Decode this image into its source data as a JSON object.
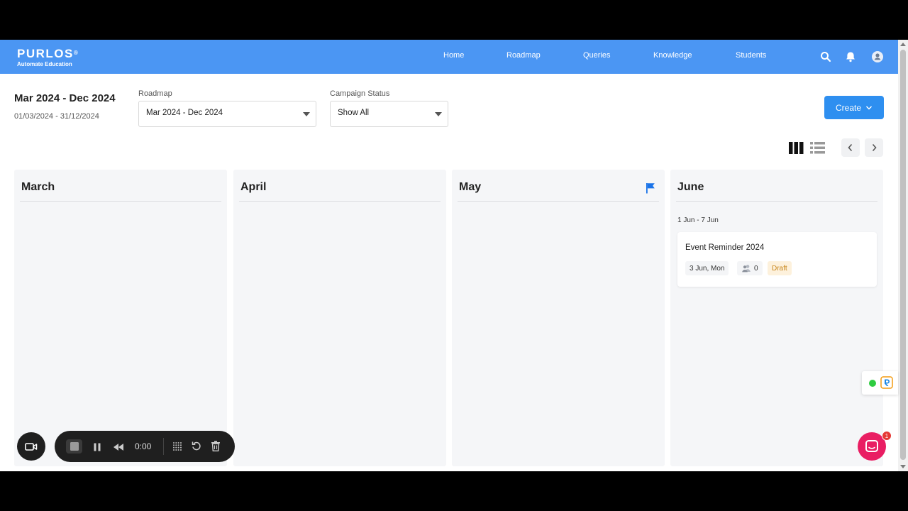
{
  "brand": {
    "name": "PURLOS",
    "mark": "®",
    "tagline": "Automate Education"
  },
  "nav": {
    "items": [
      {
        "label": "Home"
      },
      {
        "label": "Roadmap"
      },
      {
        "label": "Queries"
      },
      {
        "label": "Knowledge"
      },
      {
        "label": "Students"
      }
    ],
    "icons": [
      "search-icon",
      "bell-icon",
      "user-avatar-icon"
    ]
  },
  "toolbar": {
    "range_title": "Mar 2024 - Dec 2024",
    "range_dates": "01/03/2024 - 31/12/2024",
    "roadmap_label": "Roadmap",
    "roadmap_value": "Mar 2024 - Dec 2024",
    "status_label": "Campaign Status",
    "status_value": "Show All",
    "create_label": "Create"
  },
  "board": {
    "months": [
      {
        "name": "March",
        "flag": false
      },
      {
        "name": "April",
        "flag": false
      },
      {
        "name": "May",
        "flag": true
      },
      {
        "name": "June",
        "flag": false
      }
    ],
    "june_week": "1 Jun - 7 Jun",
    "card": {
      "title": "Event Reminder 2024",
      "date": "3 Jun, Mon",
      "count": "0",
      "status": "Draft"
    }
  },
  "recorder": {
    "time": "0:00"
  },
  "chat": {
    "badge": "1"
  },
  "colors": {
    "header": "#4b96f3",
    "primary": "#2e8ff0",
    "draft_bg": "#fdf1dc",
    "draft_text": "#c8861b",
    "chat": "#e91e63"
  }
}
